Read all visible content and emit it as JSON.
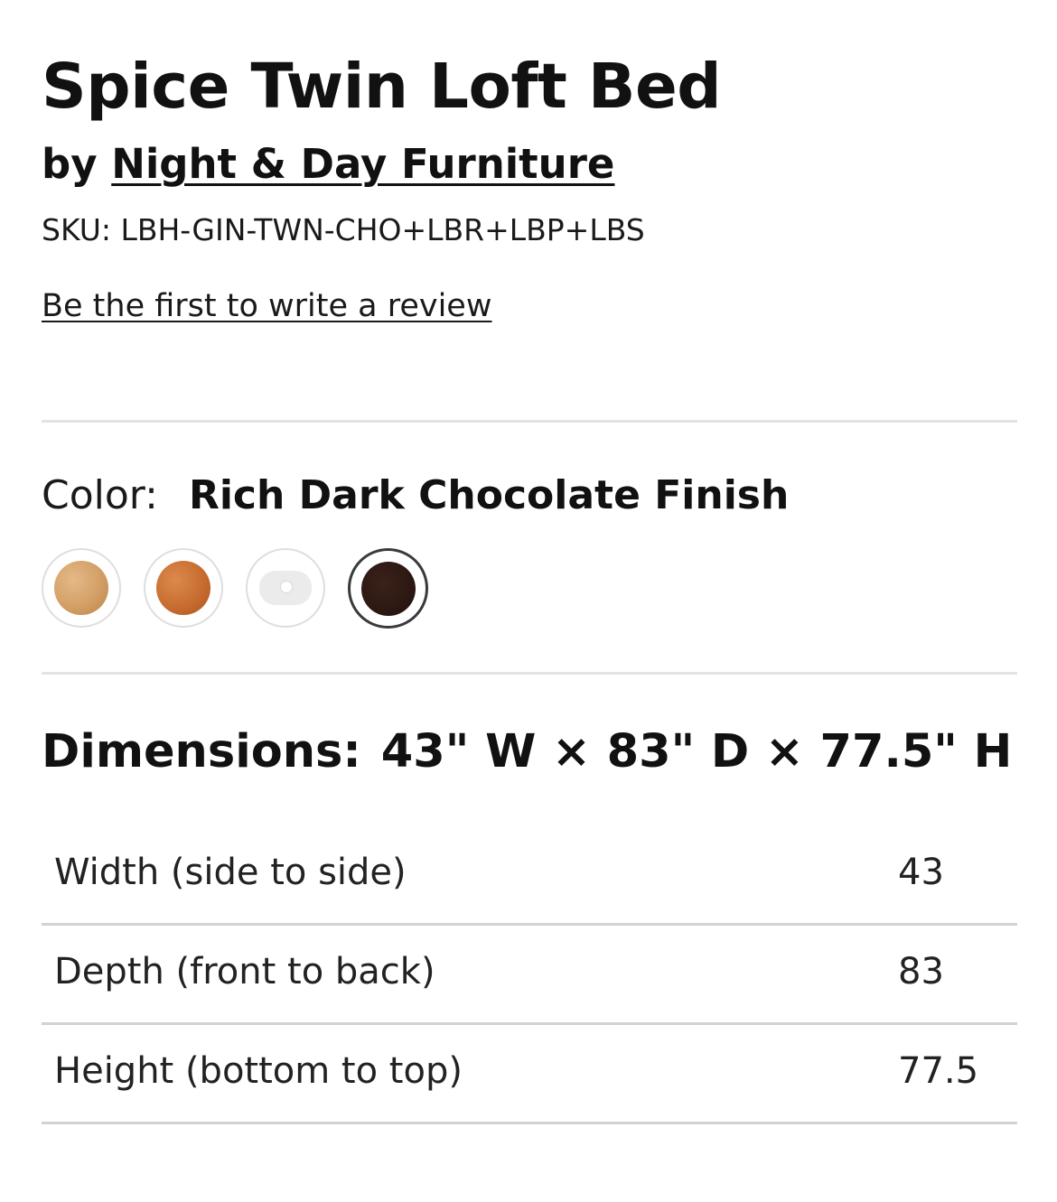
{
  "product": {
    "title": "Spice Twin Loft Bed",
    "by_prefix": "by",
    "brand": "Night & Day Furniture",
    "sku": "SKU: LBH-GIN-TWN-CHO+LBR+LBP+LBS",
    "review_link": "Be the first to write a review"
  },
  "color": {
    "label": "Color:",
    "selected_value": "Rich Dark Chocolate Finish",
    "swatches": [
      {
        "icon": "natural-wood-swatch",
        "hex": "#d39f66",
        "selected": false
      },
      {
        "icon": "cherry-wood-swatch",
        "hex": "#c66a2e",
        "selected": false
      },
      {
        "icon": "white-finish-swatch",
        "hex": "#ebebeb",
        "selected": false
      },
      {
        "icon": "chocolate-finish-swatch",
        "hex": "#2a1611",
        "selected": true
      }
    ]
  },
  "dimensions": {
    "label": "Dimensions:",
    "summary": "43\" W × 83\" D × 77.5\" H",
    "rows": [
      {
        "label": "Width (side to side)",
        "value": "43"
      },
      {
        "label": "Depth (front to back)",
        "value": "83"
      },
      {
        "label": "Height (bottom to top)",
        "value": "77.5"
      }
    ]
  }
}
